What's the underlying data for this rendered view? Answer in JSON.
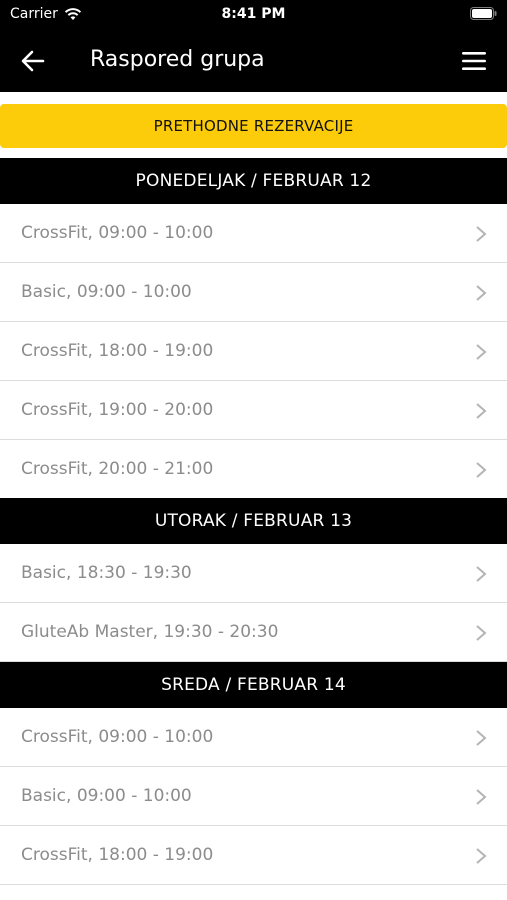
{
  "status": {
    "carrier": "Carrier",
    "time": "8:41 PM"
  },
  "nav": {
    "title": "Raspored grupa",
    "back_icon": "arrow-left-icon",
    "menu_icon": "hamburger-menu-icon"
  },
  "prev_button": {
    "label": "PRETHODNE REZERVACIJE",
    "color": "#fccc0a"
  },
  "days": [
    {
      "header": "PONEDELJAK / FEBRUAR 12",
      "items": [
        "CrossFit, 09:00 - 10:00",
        "Basic, 09:00 - 10:00",
        "CrossFit, 18:00 - 19:00",
        "CrossFit, 19:00 - 20:00",
        "CrossFit, 20:00 - 21:00"
      ]
    },
    {
      "header": "UTORAK / FEBRUAR 13",
      "items": [
        "Basic, 18:30 - 19:30",
        "GluteAb Master, 19:30 - 20:30"
      ]
    },
    {
      "header": "SREDA / FEBRUAR 14",
      "items": [
        "CrossFit, 09:00 - 10:00",
        "Basic, 09:00 - 10:00",
        "CrossFit, 18:00 - 19:00"
      ]
    }
  ]
}
